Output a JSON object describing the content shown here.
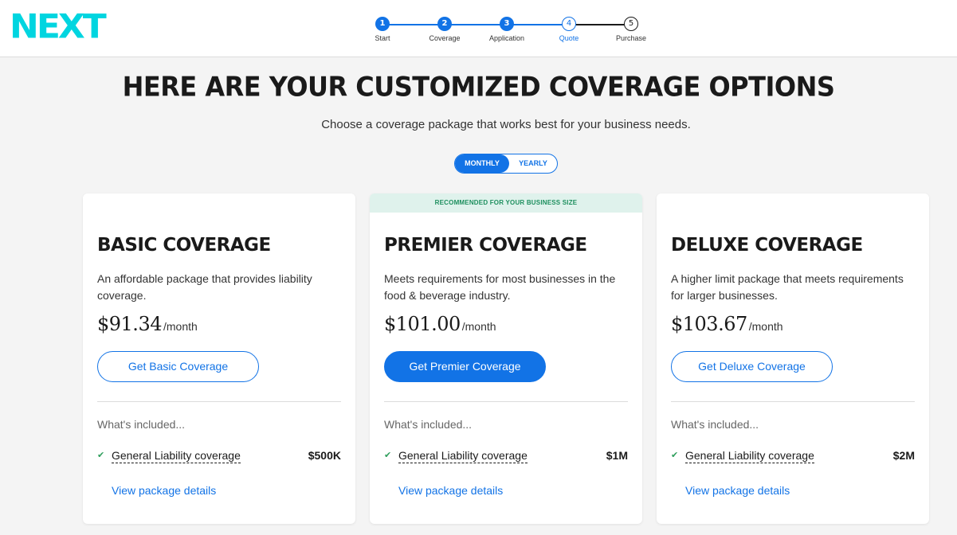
{
  "header": {
    "logo": "NEXT"
  },
  "stepper": {
    "steps": [
      {
        "number": "1",
        "label": "Start",
        "state": "done"
      },
      {
        "number": "2",
        "label": "Coverage",
        "state": "done"
      },
      {
        "number": "3",
        "label": "Application",
        "state": "done"
      },
      {
        "number": "4",
        "label": "Quote",
        "state": "current"
      },
      {
        "number": "5",
        "label": "Purchase",
        "state": "todo"
      }
    ]
  },
  "main": {
    "title": "HERE ARE YOUR CUSTOMIZED COVERAGE OPTIONS",
    "subtitle": "Choose a coverage package that works best for your business needs.",
    "toggle": {
      "monthly": "MONTHLY",
      "yearly": "YEARLY",
      "selected": "monthly"
    }
  },
  "plans": [
    {
      "banner": "",
      "title": "BASIC COVERAGE",
      "description": "An affordable package that provides liability coverage.",
      "price": "$91.34",
      "per": "/month",
      "cta": "Get Basic Coverage",
      "included_label": "What's included...",
      "coverage_label": "General Liability coverage",
      "coverage_amount": "$500K",
      "details_link": "View package details"
    },
    {
      "banner": "RECOMMENDED FOR YOUR BUSINESS SIZE",
      "title": "PREMIER COVERAGE",
      "description": "Meets requirements for most businesses in the food & beverage industry.",
      "price": "$101.00",
      "per": "/month",
      "cta": "Get Premier Coverage",
      "included_label": "What's included...",
      "coverage_label": "General Liability coverage",
      "coverage_amount": "$1M",
      "details_link": "View package details"
    },
    {
      "banner": "",
      "title": "DELUXE COVERAGE",
      "description": "A higher limit package that meets requirements for larger businesses.",
      "price": "$103.67",
      "per": "/month",
      "cta": "Get Deluxe Coverage",
      "included_label": "What's included...",
      "coverage_label": "General Liability coverage",
      "coverage_amount": "$2M",
      "details_link": "View package details"
    }
  ],
  "colors": {
    "brand": "#00d5e0",
    "accent": "#1273e6",
    "recommended_bg": "#dff2ec",
    "recommended_text": "#1d8f5e",
    "check": "#2e9e5c"
  }
}
